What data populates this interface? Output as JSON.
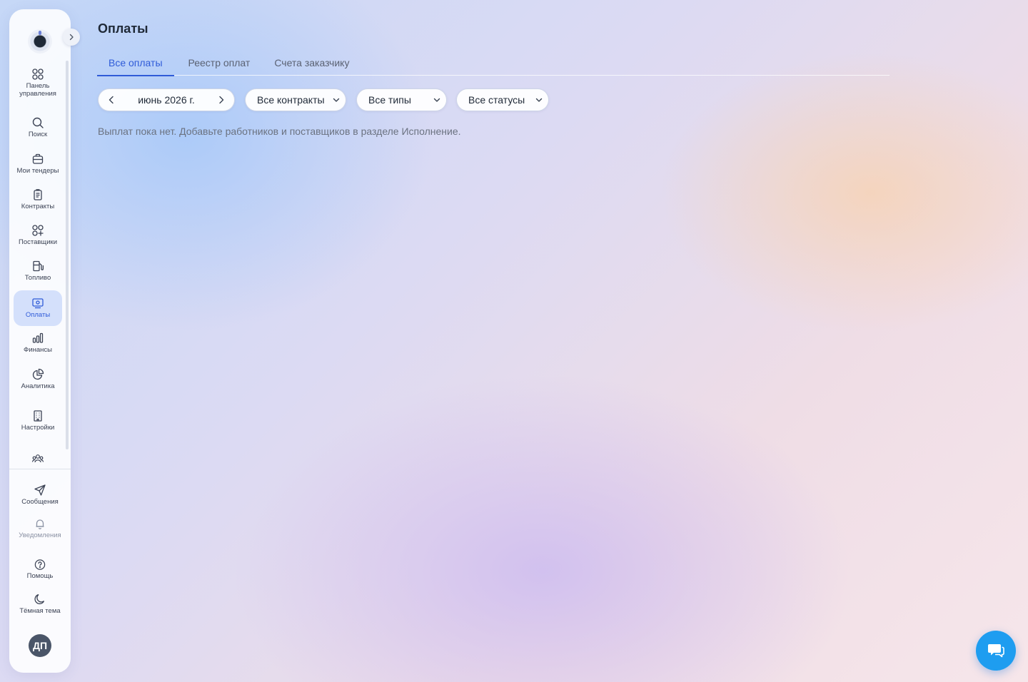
{
  "colors": {
    "accent": "#2f5bd8",
    "chat_button": "#1e9df0",
    "avatar_bg": "#4a5568"
  },
  "sidebar": {
    "items": [
      {
        "label": "Панель управления",
        "icon": "grid-icon"
      },
      {
        "label": "Поиск",
        "icon": "search-icon"
      },
      {
        "label": "Мои тендеры",
        "icon": "briefcase-icon"
      },
      {
        "label": "Контракты",
        "icon": "documents-icon"
      },
      {
        "label": "Поставщики",
        "icon": "grid-plus-icon"
      },
      {
        "label": "Топливо",
        "icon": "fuel-icon"
      },
      {
        "label": "Оплаты",
        "icon": "payment-icon",
        "active": true
      },
      {
        "label": "Финансы",
        "icon": "bar-chart-icon"
      },
      {
        "label": "Аналитика",
        "icon": "pie-chart-icon"
      },
      {
        "label": "Настройки",
        "icon": "building-icon"
      },
      {
        "label": "",
        "icon": "team-icon"
      }
    ],
    "bottom": [
      {
        "label": "Сообщения",
        "icon": "send-icon"
      },
      {
        "label": "Уведомления",
        "icon": "bell-icon"
      },
      {
        "label": "Помощь",
        "icon": "help-icon"
      },
      {
        "label": "Тёмная тема",
        "icon": "moon-icon"
      }
    ],
    "avatar_initials": "ДП"
  },
  "page": {
    "title": "Оплаты",
    "tabs": [
      {
        "label": "Все оплаты",
        "active": true
      },
      {
        "label": "Реестр оплат"
      },
      {
        "label": "Счета заказчику"
      }
    ],
    "filters": {
      "month": "июнь 2026 г.",
      "contracts": "Все контракты",
      "types": "Все типы",
      "statuses": "Все статусы"
    },
    "empty_message": "Выплат пока нет. Добавьте работников и поставщиков в разделе Исполнение."
  }
}
